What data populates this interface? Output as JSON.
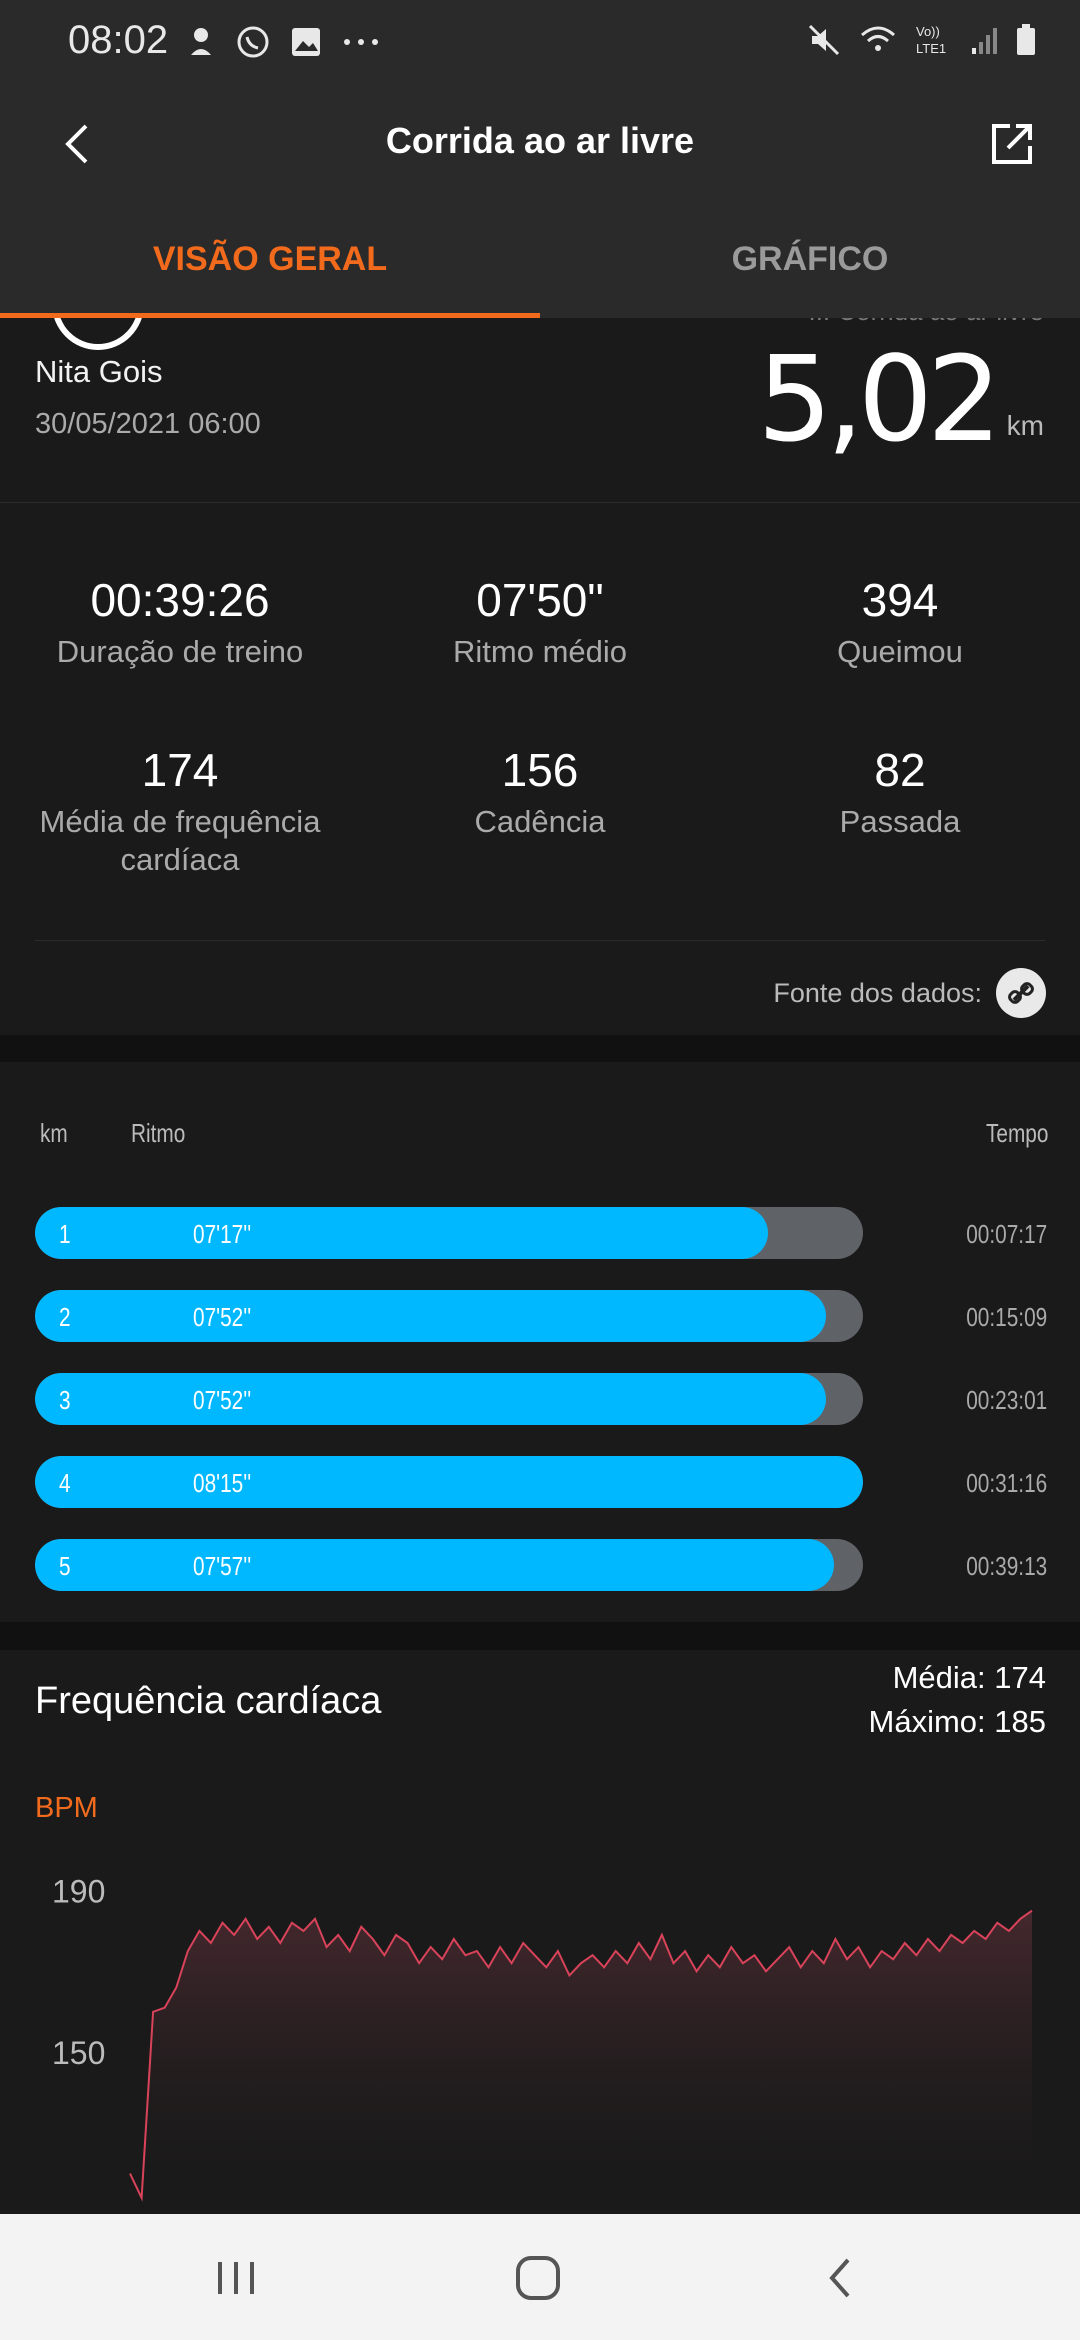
{
  "status_bar": {
    "time": "08:02",
    "left_icons": [
      "beach-icon",
      "whatsapp-icon",
      "gallery-icon",
      "more-dots-icon"
    ],
    "right_icons": [
      "mute-icon",
      "wifi-icon",
      "volte-icon",
      "signal-icon",
      "battery-icon"
    ],
    "volte_text": "Vo))\nLTE1"
  },
  "app_bar": {
    "title": "Corrida ao ar livre"
  },
  "tabs": [
    {
      "label": "VISÃO GERAL",
      "active": true
    },
    {
      "label": "GRÁFICO",
      "active": false
    }
  ],
  "summary": {
    "subtitle_partial": "... Corrida ao ar livre",
    "user_name": "Nita Gois",
    "date": "30/05/2021 06:00",
    "distance": "5,02",
    "distance_unit": "km"
  },
  "stats": [
    {
      "value": "00:39:26",
      "label": "Duração de treino"
    },
    {
      "value": "07'50\"",
      "label": "Ritmo médio"
    },
    {
      "value": "394",
      "label": "Queimou"
    },
    {
      "value": "174",
      "label": "Média de frequência cardíaca"
    },
    {
      "value": "156",
      "label": "Cadência"
    },
    {
      "value": "82",
      "label": "Passada"
    }
  ],
  "data_source": {
    "label": "Fonte dos dados:",
    "icon": "link-icon"
  },
  "pace_table": {
    "headers": {
      "km": "km",
      "pace": "Ritmo",
      "time": "Tempo"
    },
    "rows": [
      {
        "km": "1",
        "pace": "07'17''",
        "time": "00:07:17",
        "fill": 0.885
      },
      {
        "km": "2",
        "pace": "07'52''",
        "time": "00:15:09",
        "fill": 0.955
      },
      {
        "km": "3",
        "pace": "07'52''",
        "time": "00:23:01",
        "fill": 0.955
      },
      {
        "km": "4",
        "pace": "08'15''",
        "time": "00:31:16",
        "fill": 1.0
      },
      {
        "km": "5",
        "pace": "07'57''",
        "time": "00:39:13",
        "fill": 0.965
      }
    ],
    "fill_color": "#00b8ff",
    "track_color": "#5f6267"
  },
  "heart_rate": {
    "title": "Frequência cardíaca",
    "average": "Média: 174",
    "maximum": "Máximo: 185",
    "unit": "BPM",
    "line_color": "#d9435a"
  },
  "chart_data": {
    "type": "line",
    "title": "Frequência cardíaca",
    "ylabel": "BPM",
    "yticks": [
      190,
      150
    ],
    "ylim": [
      110,
      200
    ],
    "x": [
      0,
      0.5,
      1,
      1.5,
      2,
      2.5,
      3,
      3.5,
      4,
      4.5,
      5,
      5.5,
      6,
      6.5,
      7,
      7.5,
      8,
      8.5,
      9,
      9.5,
      10,
      10.5,
      11,
      11.5,
      12,
      12.5,
      13,
      13.5,
      14,
      14.5,
      15,
      15.5,
      16,
      16.5,
      17,
      17.5,
      18,
      18.5,
      19,
      19.5,
      20,
      20.5,
      21,
      21.5,
      22,
      22.5,
      23,
      23.5,
      24,
      24.5,
      25,
      25.5,
      26,
      26.5,
      27,
      27.5,
      28,
      28.5,
      29,
      29.5,
      30,
      30.5,
      31,
      31.5,
      32,
      32.5,
      33,
      33.5,
      34,
      34.5,
      35,
      35.5,
      36,
      36.5,
      37,
      37.5,
      38,
      38.5,
      39
    ],
    "series": [
      {
        "values": [
          120,
          114,
          160,
          161,
          166,
          175,
          180,
          177,
          182,
          179,
          183,
          178,
          181,
          177,
          182,
          180,
          183,
          176,
          179,
          175,
          181,
          178,
          174,
          179,
          177,
          172,
          176,
          173,
          178,
          174,
          175,
          171,
          176,
          172,
          177,
          174,
          171,
          175,
          169,
          172,
          174,
          171,
          175,
          172,
          177,
          173,
          179,
          172,
          175,
          170,
          174,
          171,
          176,
          172,
          174,
          170,
          173,
          176,
          171,
          175,
          172,
          178,
          173,
          176,
          171,
          175,
          173,
          177,
          174,
          178,
          175,
          179,
          177,
          180,
          178,
          182,
          180,
          183,
          185
        ]
      }
    ]
  },
  "nav_bar": {
    "buttons": [
      "recent-apps-icon",
      "home-icon",
      "back-icon"
    ]
  }
}
